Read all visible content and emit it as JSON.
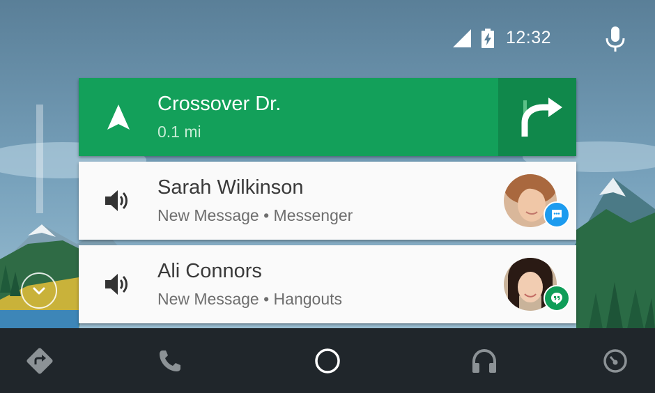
{
  "status_bar": {
    "time": "12:32",
    "icons": [
      "signal-icon",
      "battery-charging-icon",
      "microphone-icon"
    ]
  },
  "navigation_card": {
    "street": "Crossover Dr.",
    "distance": "0.1 mi",
    "icons": [
      "navigation-arrow-icon",
      "turn-right-icon"
    ],
    "colors": {
      "card": "#13a05a",
      "turn_panel": "#10884b"
    }
  },
  "notifications": [
    {
      "name": "Sarah Wilkinson",
      "detail": "New Message • Messenger",
      "app_icon": "messenger-icon",
      "app_color": "#1c9bef"
    },
    {
      "name": "Ali Connors",
      "detail": "New Message • Hangouts",
      "app_icon": "hangouts-icon",
      "app_color": "#0f9d58"
    }
  ],
  "bottom_nav": {
    "items": [
      "navigation-icon",
      "phone-icon",
      "home-icon",
      "headphones-icon",
      "car-overview-icon"
    ]
  },
  "colors": {
    "bottom_bar": "#20262b",
    "card_background": "#fafafa"
  }
}
